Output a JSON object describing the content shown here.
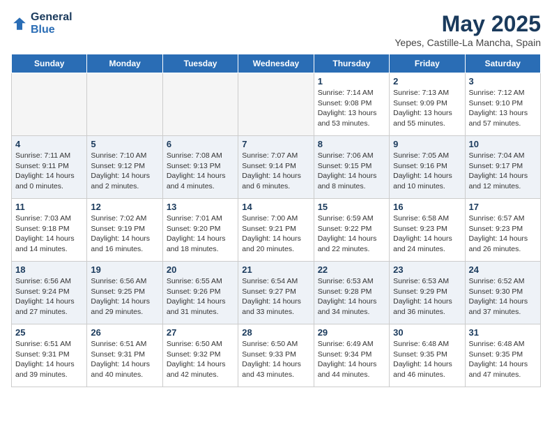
{
  "header": {
    "logo_line1": "General",
    "logo_line2": "Blue",
    "title": "May 2025",
    "subtitle": "Yepes, Castille-La Mancha, Spain"
  },
  "days_of_week": [
    "Sunday",
    "Monday",
    "Tuesday",
    "Wednesday",
    "Thursday",
    "Friday",
    "Saturday"
  ],
  "weeks": [
    [
      {
        "day": "",
        "text": ""
      },
      {
        "day": "",
        "text": ""
      },
      {
        "day": "",
        "text": ""
      },
      {
        "day": "",
        "text": ""
      },
      {
        "day": "1",
        "text": "Sunrise: 7:14 AM\nSunset: 9:08 PM\nDaylight: 13 hours\nand 53 minutes."
      },
      {
        "day": "2",
        "text": "Sunrise: 7:13 AM\nSunset: 9:09 PM\nDaylight: 13 hours\nand 55 minutes."
      },
      {
        "day": "3",
        "text": "Sunrise: 7:12 AM\nSunset: 9:10 PM\nDaylight: 13 hours\nand 57 minutes."
      }
    ],
    [
      {
        "day": "4",
        "text": "Sunrise: 7:11 AM\nSunset: 9:11 PM\nDaylight: 14 hours\nand 0 minutes."
      },
      {
        "day": "5",
        "text": "Sunrise: 7:10 AM\nSunset: 9:12 PM\nDaylight: 14 hours\nand 2 minutes."
      },
      {
        "day": "6",
        "text": "Sunrise: 7:08 AM\nSunset: 9:13 PM\nDaylight: 14 hours\nand 4 minutes."
      },
      {
        "day": "7",
        "text": "Sunrise: 7:07 AM\nSunset: 9:14 PM\nDaylight: 14 hours\nand 6 minutes."
      },
      {
        "day": "8",
        "text": "Sunrise: 7:06 AM\nSunset: 9:15 PM\nDaylight: 14 hours\nand 8 minutes."
      },
      {
        "day": "9",
        "text": "Sunrise: 7:05 AM\nSunset: 9:16 PM\nDaylight: 14 hours\nand 10 minutes."
      },
      {
        "day": "10",
        "text": "Sunrise: 7:04 AM\nSunset: 9:17 PM\nDaylight: 14 hours\nand 12 minutes."
      }
    ],
    [
      {
        "day": "11",
        "text": "Sunrise: 7:03 AM\nSunset: 9:18 PM\nDaylight: 14 hours\nand 14 minutes."
      },
      {
        "day": "12",
        "text": "Sunrise: 7:02 AM\nSunset: 9:19 PM\nDaylight: 14 hours\nand 16 minutes."
      },
      {
        "day": "13",
        "text": "Sunrise: 7:01 AM\nSunset: 9:20 PM\nDaylight: 14 hours\nand 18 minutes."
      },
      {
        "day": "14",
        "text": "Sunrise: 7:00 AM\nSunset: 9:21 PM\nDaylight: 14 hours\nand 20 minutes."
      },
      {
        "day": "15",
        "text": "Sunrise: 6:59 AM\nSunset: 9:22 PM\nDaylight: 14 hours\nand 22 minutes."
      },
      {
        "day": "16",
        "text": "Sunrise: 6:58 AM\nSunset: 9:23 PM\nDaylight: 14 hours\nand 24 minutes."
      },
      {
        "day": "17",
        "text": "Sunrise: 6:57 AM\nSunset: 9:23 PM\nDaylight: 14 hours\nand 26 minutes."
      }
    ],
    [
      {
        "day": "18",
        "text": "Sunrise: 6:56 AM\nSunset: 9:24 PM\nDaylight: 14 hours\nand 27 minutes."
      },
      {
        "day": "19",
        "text": "Sunrise: 6:56 AM\nSunset: 9:25 PM\nDaylight: 14 hours\nand 29 minutes."
      },
      {
        "day": "20",
        "text": "Sunrise: 6:55 AM\nSunset: 9:26 PM\nDaylight: 14 hours\nand 31 minutes."
      },
      {
        "day": "21",
        "text": "Sunrise: 6:54 AM\nSunset: 9:27 PM\nDaylight: 14 hours\nand 33 minutes."
      },
      {
        "day": "22",
        "text": "Sunrise: 6:53 AM\nSunset: 9:28 PM\nDaylight: 14 hours\nand 34 minutes."
      },
      {
        "day": "23",
        "text": "Sunrise: 6:53 AM\nSunset: 9:29 PM\nDaylight: 14 hours\nand 36 minutes."
      },
      {
        "day": "24",
        "text": "Sunrise: 6:52 AM\nSunset: 9:30 PM\nDaylight: 14 hours\nand 37 minutes."
      }
    ],
    [
      {
        "day": "25",
        "text": "Sunrise: 6:51 AM\nSunset: 9:31 PM\nDaylight: 14 hours\nand 39 minutes."
      },
      {
        "day": "26",
        "text": "Sunrise: 6:51 AM\nSunset: 9:31 PM\nDaylight: 14 hours\nand 40 minutes."
      },
      {
        "day": "27",
        "text": "Sunrise: 6:50 AM\nSunset: 9:32 PM\nDaylight: 14 hours\nand 42 minutes."
      },
      {
        "day": "28",
        "text": "Sunrise: 6:50 AM\nSunset: 9:33 PM\nDaylight: 14 hours\nand 43 minutes."
      },
      {
        "day": "29",
        "text": "Sunrise: 6:49 AM\nSunset: 9:34 PM\nDaylight: 14 hours\nand 44 minutes."
      },
      {
        "day": "30",
        "text": "Sunrise: 6:48 AM\nSunset: 9:35 PM\nDaylight: 14 hours\nand 46 minutes."
      },
      {
        "day": "31",
        "text": "Sunrise: 6:48 AM\nSunset: 9:35 PM\nDaylight: 14 hours\nand 47 minutes."
      }
    ]
  ]
}
